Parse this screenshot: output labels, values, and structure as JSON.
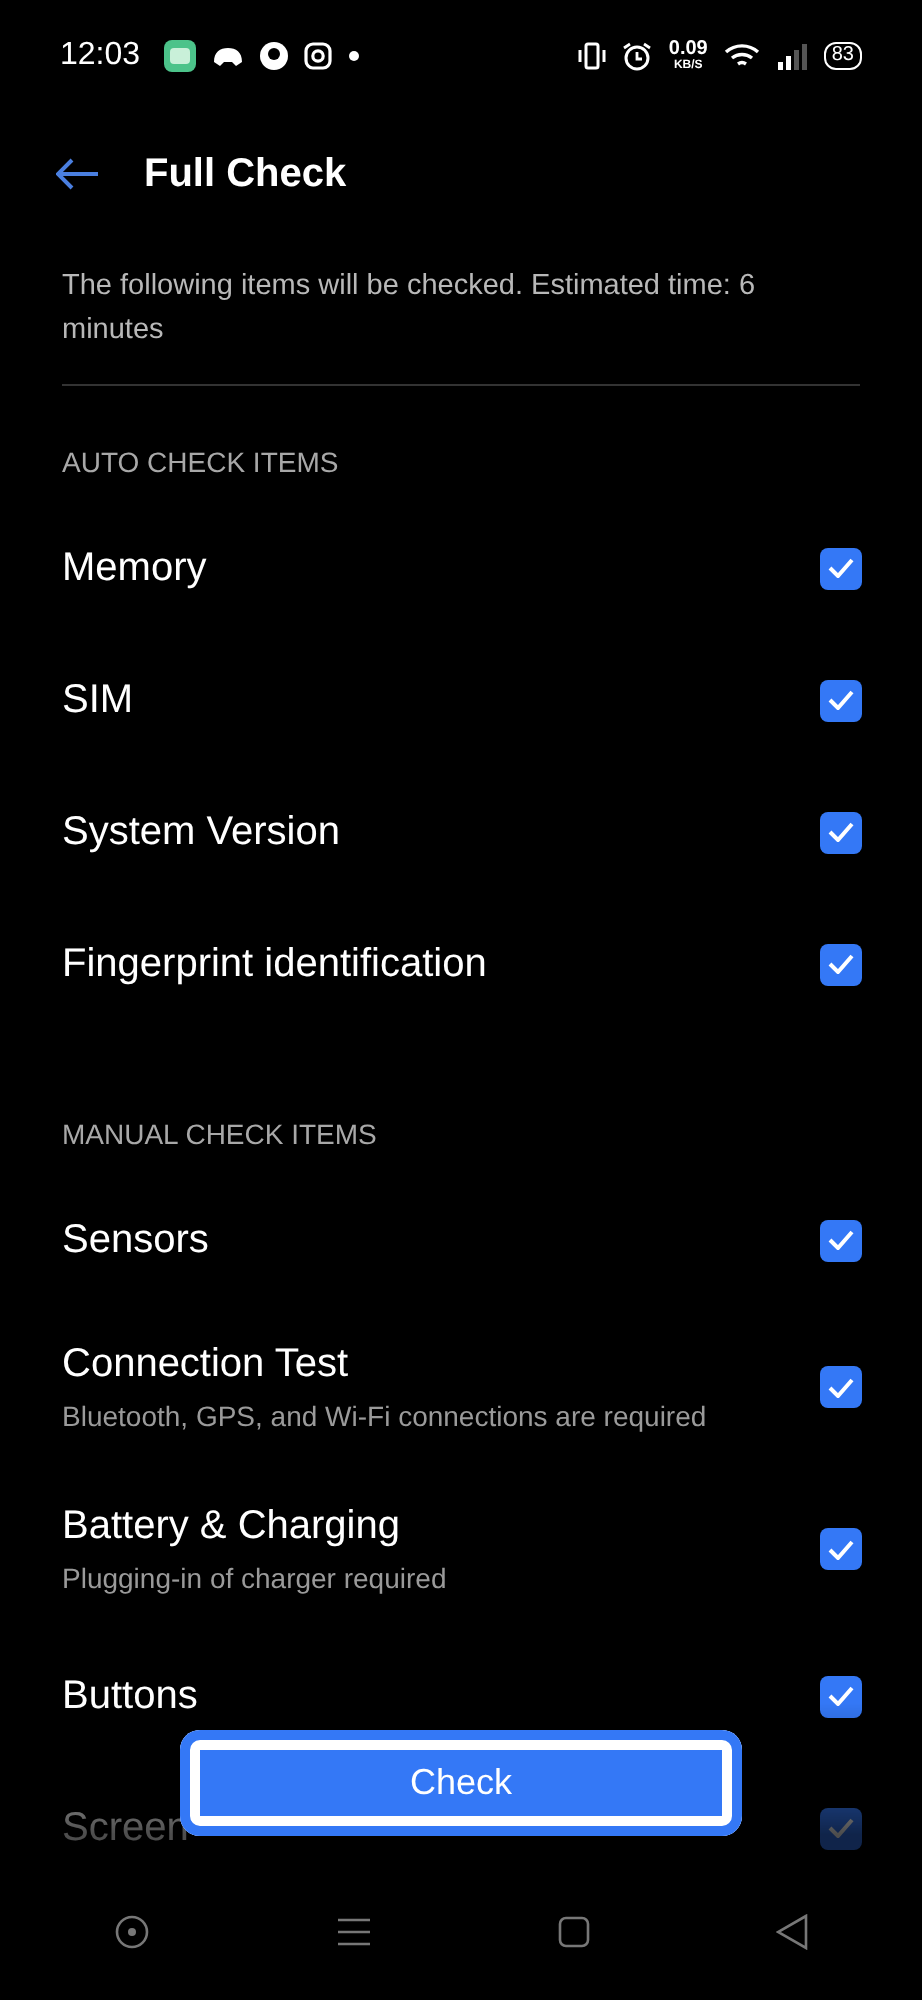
{
  "status_bar": {
    "time": "12:03",
    "net_speed": "0.09",
    "net_unit": "KB/S",
    "battery": "83"
  },
  "header": {
    "title": "Full Check"
  },
  "description": "The following items will be checked. Estimated time: 6 minutes",
  "sections": [
    {
      "title": "AUTO CHECK ITEMS",
      "items": [
        {
          "label": "Memory",
          "checked": true
        },
        {
          "label": "SIM",
          "checked": true
        },
        {
          "label": "System Version",
          "checked": true
        },
        {
          "label": "Fingerprint identification",
          "checked": true
        }
      ]
    },
    {
      "title": "MANUAL CHECK ITEMS",
      "items": [
        {
          "label": "Sensors",
          "checked": true
        },
        {
          "label": "Connection Test",
          "subtitle": "Bluetooth, GPS, and Wi-Fi connections are required",
          "checked": true
        },
        {
          "label": "Battery & Charging",
          "subtitle": "Plugging-in of charger required",
          "checked": true
        },
        {
          "label": "Buttons",
          "checked": true
        },
        {
          "label": "Screen",
          "checked": true
        }
      ]
    }
  ],
  "check_button": {
    "label": "Check",
    "focused": true
  }
}
